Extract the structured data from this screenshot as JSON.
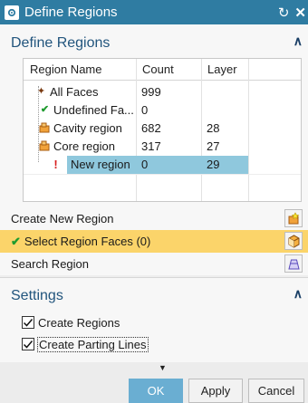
{
  "window": {
    "title": "Define Regions",
    "reset_icon": "reset-icon",
    "close_icon": "close-icon"
  },
  "define_section": {
    "header": "Define Regions",
    "table": {
      "columns": [
        "Region Name",
        "Count",
        "Layer"
      ],
      "rows": [
        {
          "name": "All Faces",
          "count": "999",
          "layer": "",
          "icon": "all-faces-icon"
        },
        {
          "name": "Undefined Fa...",
          "count": "0",
          "layer": "",
          "icon": "checkmark-icon"
        },
        {
          "name": "Cavity region",
          "count": "682",
          "layer": "28",
          "icon": "cavity-region-icon"
        },
        {
          "name": "Core region",
          "count": "317",
          "layer": "27",
          "icon": "core-region-icon"
        },
        {
          "name": "New region",
          "count": "0",
          "layer": "29",
          "icon": "warning-exclamation-icon",
          "selected": true
        }
      ]
    },
    "create_new_region": "Create New Region",
    "select_region_faces": "Select Region Faces (0)",
    "search_region": "Search Region"
  },
  "settings_section": {
    "header": "Settings",
    "create_regions": {
      "label": "Create Regions",
      "checked": true
    },
    "create_parting_lines": {
      "label": "Create Parting Lines",
      "checked": true
    }
  },
  "buttons": {
    "ok": "OK",
    "apply": "Apply",
    "cancel": "Cancel"
  },
  "colors": {
    "titlebar": "#2f7ca2",
    "section_text": "#22557d",
    "selection": "#8fc8dd",
    "active_row": "#fbd46a",
    "ok_button": "#6aaed2"
  }
}
